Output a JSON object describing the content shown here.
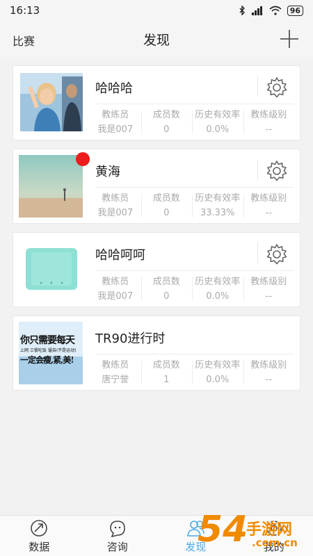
{
  "status": {
    "time": "16:13",
    "battery": "96"
  },
  "header": {
    "left": "比赛",
    "title": "发现"
  },
  "stat_labels": [
    "教练员",
    "成员数",
    "历史有效率",
    "教练级别"
  ],
  "cards": [
    {
      "name": "哈哈哈",
      "coach": "我是007",
      "members": "0",
      "rate": "0.0%",
      "level": "--"
    },
    {
      "name": "黄海",
      "coach": "我是007",
      "members": "0",
      "rate": "33.33%",
      "level": "--"
    },
    {
      "name": "哈哈呵呵",
      "coach": "我是007",
      "members": "0",
      "rate": "0.0%",
      "level": "--"
    },
    {
      "name": "TR90进行时",
      "coach": "唐宁誉",
      "members": "1",
      "rate": "0.0%",
      "level": "--"
    }
  ],
  "thumb4": {
    "line1": "你只需要每天",
    "line2": "上网 三餐吃饭 遛自(不是运动)",
    "line3": "一定会瘦,紧,美!"
  },
  "tabs": [
    "数据",
    "咨询",
    "发现",
    "我的"
  ],
  "watermark": {
    "big": "54",
    "small": "手游网",
    "domain": ".com.cn"
  },
  "colors": {
    "accent": "#4aa8e8",
    "badge": "#ee1c1c",
    "watermark": "#f08a00"
  }
}
